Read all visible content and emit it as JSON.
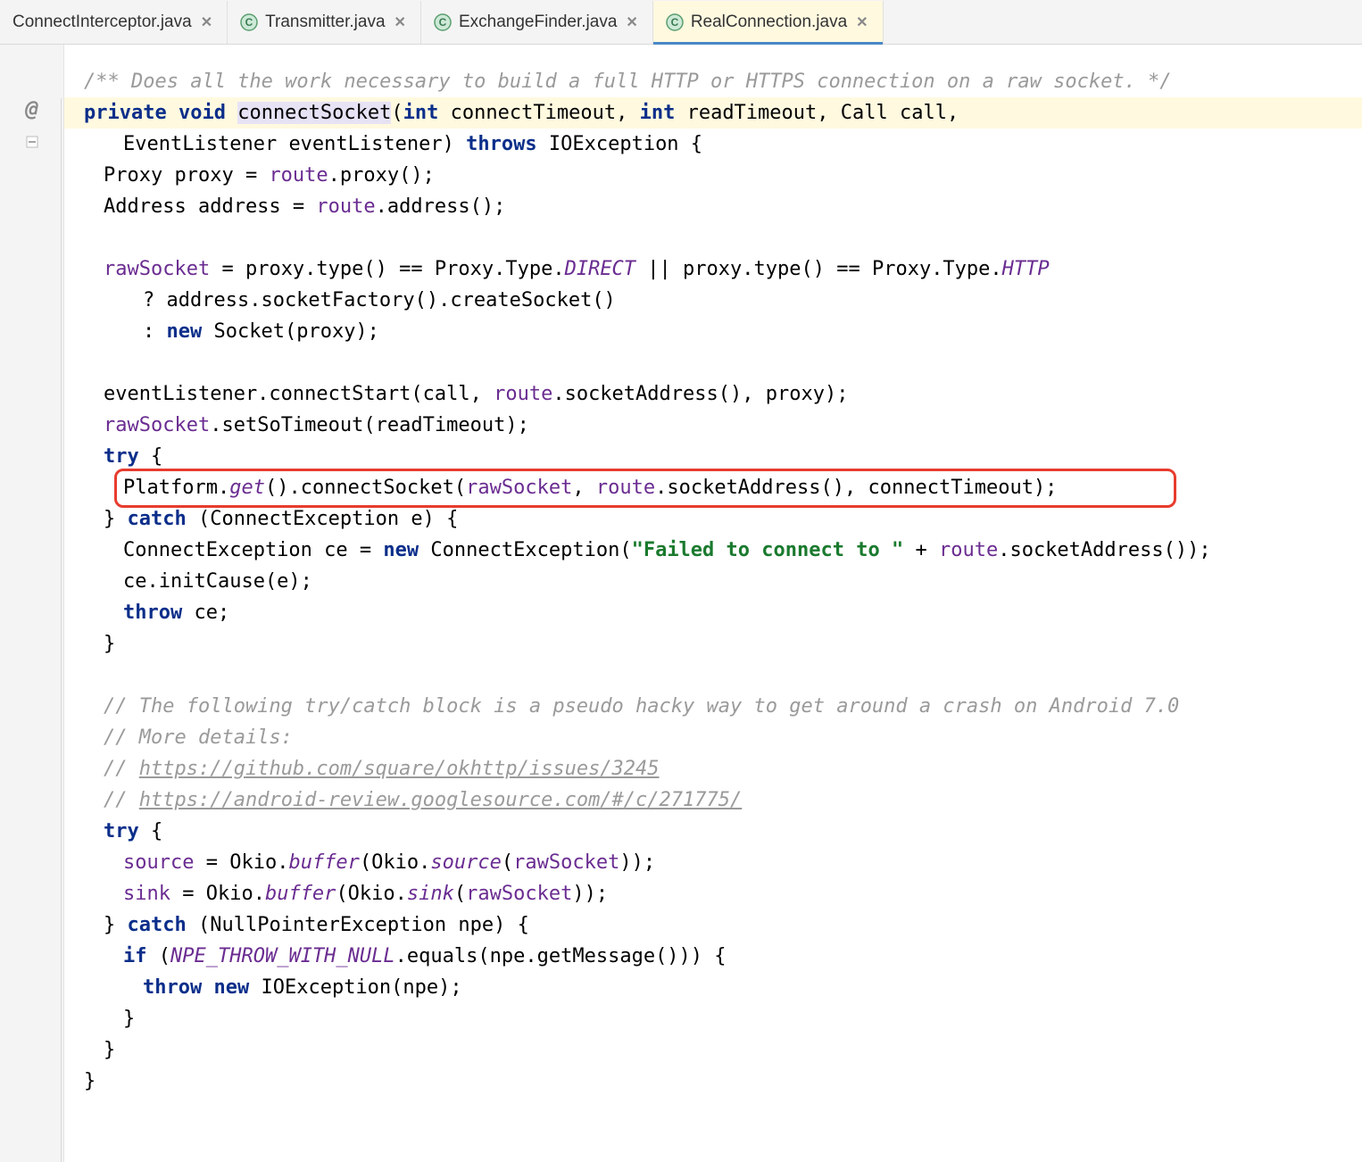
{
  "tabs": [
    {
      "label": "ConnectInterceptor.java",
      "icon": false,
      "active": false
    },
    {
      "label": "Transmitter.java",
      "icon": true,
      "active": false
    },
    {
      "label": "ExchangeFinder.java",
      "icon": true,
      "active": false
    },
    {
      "label": "RealConnection.java",
      "icon": true,
      "active": true
    }
  ],
  "gutter": {
    "override_symbol": "@"
  },
  "code": {
    "c1": "/** Does all the work necessary to build a full HTTP or HTTPS connection on a raw socket. */",
    "kw_private": "private",
    "kw_void": "void",
    "m_name": "connectSocket",
    "kw_int": "int",
    "p_ct": "connectTimeout",
    "p_rt": "readTimeout",
    "t_call": "Call",
    "p_call": "call",
    "t_el": "EventListener",
    "p_el": "eventListener",
    "kw_throws": "throws",
    "t_ioe": "IOException",
    "l4a": "Proxy proxy = ",
    "route": "route",
    "l4b": ".proxy();",
    "l5a": "Address address = ",
    "l5b": ".address();",
    "rsock": "rawSocket",
    "l7a": " = proxy.type() == Proxy.Type.",
    "direct": "DIRECT",
    "l7b": " || proxy.type() == Proxy.Type.",
    "http": "HTTP",
    "l8": "? address.socketFactory().createSocket()",
    "l9a": ": ",
    "kw_new": "new",
    "l9b": " Socket(proxy);",
    "l11a": "eventListener.connectStart(call, ",
    "l11b": ".socketAddress(), proxy);",
    "l12": ".setSoTimeout(readTimeout);",
    "kw_try": "try",
    "l14a": "Platform.",
    "get": "get",
    "l14b": "().connectSocket(",
    "l14c": ".socketAddress(), connectTimeout);",
    "kw_catch": "catch",
    "l15": " (ConnectException e) {",
    "l16a": "ConnectException ce = ",
    "l16b": " ConnectException(",
    "str_fail": "\"Failed to connect to \"",
    "l16c": " + ",
    "l16d": ".socketAddress());",
    "l17": "ce.initCause(e);",
    "kw_throw": "throw",
    "l18": " ce;",
    "c20": "// The following try/catch block is a pseudo hacky way to get around a crash on Android 7.0",
    "c21": "// More details:",
    "c22a": "// ",
    "lnk1": "https://github.com/square/okhttp/issues/3245",
    "c23a": "// ",
    "lnk2": "https://android-review.googlesource.com/#/c/271775/",
    "src": "source",
    "l25a": " = Okio.",
    "buf": "buffer",
    "l25b": "(Okio.",
    "srcm": "source",
    "l25c": "(",
    "l25d": "));",
    "snk": "sink",
    "snkm": "sink",
    "l27": " (NullPointerException npe) {",
    "kw_if": "if",
    "npeconst": "NPE_THROW_WITH_NULL",
    "l28": ".equals(npe.getMessage())) {",
    "l29": " IOException(npe);"
  }
}
